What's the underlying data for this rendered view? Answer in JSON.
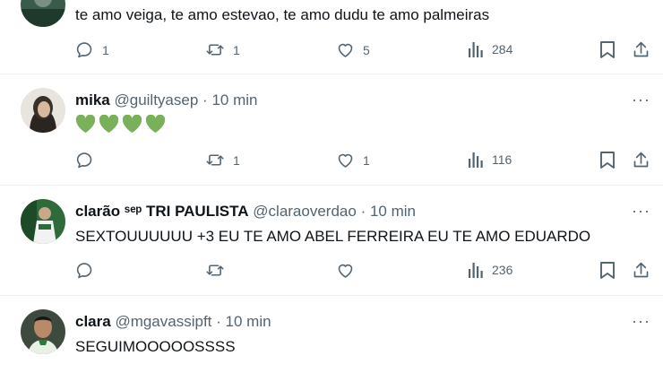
{
  "tweets": [
    {
      "text": "te amo veiga, te amo estevao, te amo dudu te amo palmeiras",
      "replies": "1",
      "retweets": "1",
      "likes": "5",
      "views": "284"
    },
    {
      "name": "mika",
      "handle": "@guiltyasep",
      "separator": "·",
      "time": "10 min",
      "replies": "",
      "retweets": "1",
      "likes": "1",
      "views": "116",
      "more": "···"
    },
    {
      "name": "clarão ˢᵉᵖ TRI PAULISTA",
      "handle": "@claraoverdao",
      "separator": "·",
      "time": "10 min",
      "text": "SEXTOUUUUUU +3 EU TE AMO ABEL FERREIRA EU TE AMO EDUARDO",
      "replies": "",
      "retweets": "",
      "likes": "",
      "views": "236",
      "more": "···"
    },
    {
      "name": "clara",
      "handle": "@mgavassipft",
      "separator": "·",
      "time": "10 min",
      "text": "SEGUIMOOOOOSSSS",
      "more": "···"
    }
  ],
  "icons": {
    "reply": "reply-icon",
    "retweet": "retweet-icon",
    "like": "heart-icon",
    "views": "views-icon",
    "bookmark": "bookmark-icon",
    "share": "share-icon",
    "heart_emoji": "green-heart-emoji"
  },
  "colors": {
    "icon": "#536471",
    "text": "#0f1419",
    "secondary": "#536471",
    "divider": "#eff3f4",
    "green_heart": "#78b159"
  }
}
